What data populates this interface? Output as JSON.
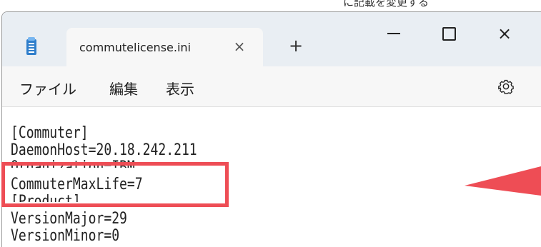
{
  "top_caption": "に記載を変更する",
  "tab": {
    "title": "commutelicense.ini",
    "close": "×",
    "new_tab": "+"
  },
  "window_controls": {
    "minimize": "—",
    "maximize": "□",
    "close": "×"
  },
  "menu": {
    "file": "ファイル",
    "edit": "編集",
    "view": "表示"
  },
  "icons": {
    "app": "notepad-icon",
    "settings": "gear-icon",
    "annotation_arrow": "red-arrow-icon"
  },
  "editor_lines": [
    "[Commuter]",
    "DaemonHost=20.18.242.211",
    "Organization=IBM",
    "CommuterMaxLife=7",
    "[Product]",
    "VersionMajor=29",
    "VersionMinor=0"
  ],
  "colors": {
    "highlight": "#ee4d55",
    "titlebar": "#e9eef3",
    "menubar": "#f7f7f7"
  }
}
